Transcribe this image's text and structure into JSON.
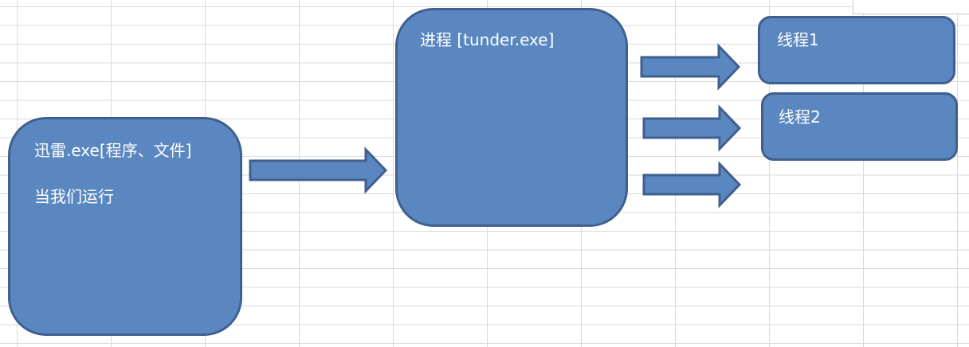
{
  "diagram": {
    "program_box": {
      "title": "迅雷.exe[程序、文件]",
      "subtitle": "当我们运行"
    },
    "process_box": {
      "title": "进程 [tunder.exe]"
    },
    "threads": [
      {
        "label": "线程1"
      },
      {
        "label": "线程2"
      }
    ],
    "colors": {
      "box_fill": "#5b87c0",
      "box_border": "#3f5f8f",
      "grid_line": "#d9d9d9",
      "text": "#ffffff"
    }
  }
}
